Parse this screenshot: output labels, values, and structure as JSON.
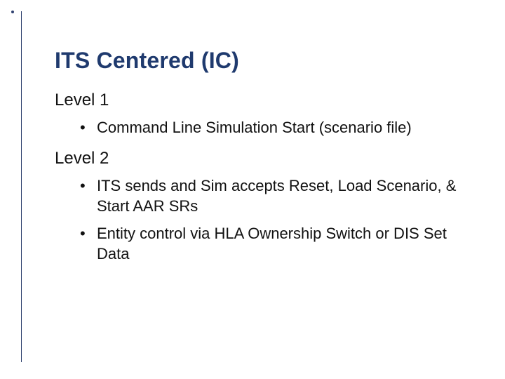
{
  "title": "ITS Centered (IC)",
  "sections": [
    {
      "heading": "Level 1",
      "items": [
        "Command Line Simulation Start (scenario file)"
      ]
    },
    {
      "heading": "Level 2",
      "items": [
        "ITS sends and Sim accepts Reset, Load Scenario, & Start AAR SRs",
        "Entity control via HLA Ownership Switch or DIS Set Data"
      ]
    }
  ]
}
